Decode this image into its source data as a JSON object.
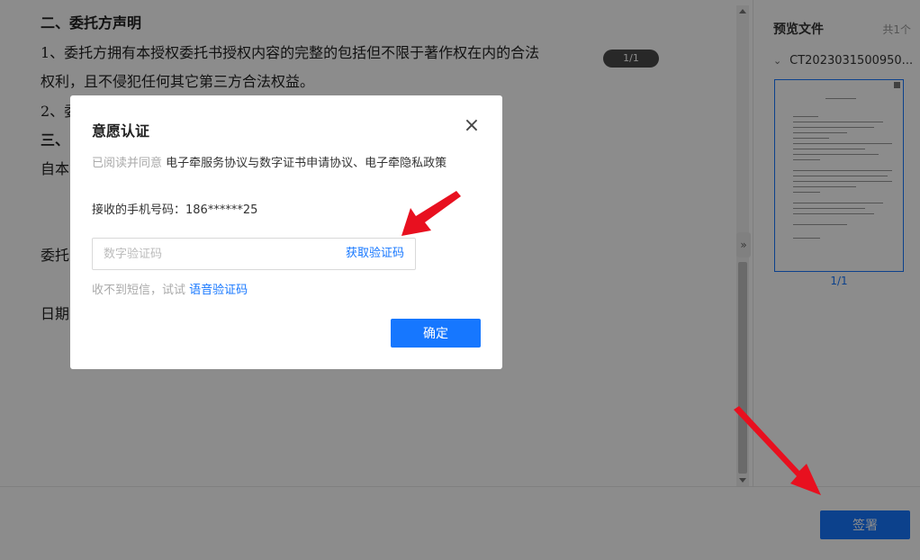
{
  "document": {
    "lines": [
      "二、委托方声明",
      "1、委托方拥有本授权委托书授权内容的完整的包括但不限于著作权在内的合法",
      "权利，且不侵犯任何其它第三方合法权益。",
      "2、委",
      "三、",
      "自本",
      "委托",
      "日期"
    ],
    "page_indicator": "1/1"
  },
  "preview": {
    "title": "预览文件",
    "count": "共1个",
    "file_name": "CT2023031500950...",
    "page_label": "1/1"
  },
  "modal": {
    "title": "意愿认证",
    "agreement_prefix": "已阅读并同意",
    "agreement_link": "电子牵服务协议与数字证书申请协议、电子牵隐私政策",
    "phone_label": "接收的手机号码：",
    "phone_value": "186******25",
    "code_placeholder": "数字验证码",
    "get_code_label": "获取验证码",
    "voice_prefix": "收不到短信，试试",
    "voice_link": "语音验证码",
    "confirm_label": "确定"
  },
  "bottom": {
    "sign_label": "签署"
  },
  "colors": {
    "accent": "#1677ff",
    "annotation_arrow": "#e8101f"
  },
  "icons": {
    "modal_close": "close-icon",
    "file_expand": "chevron-down-icon",
    "panel_collapse": "double-chevron-right-icon"
  }
}
